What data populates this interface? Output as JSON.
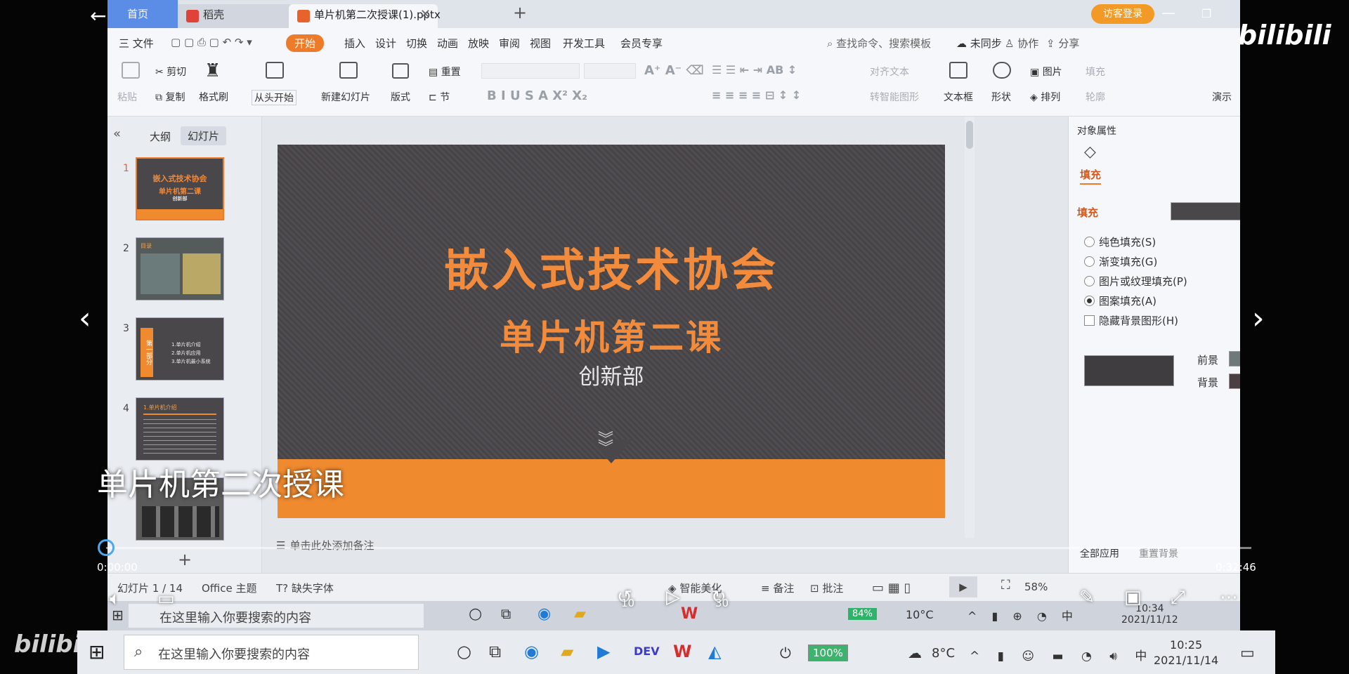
{
  "tabs": {
    "home": "首页",
    "daoke": "稻壳",
    "file": "单片机第二次授课(1).pptx",
    "login": "访客登录"
  },
  "menu": {
    "file": "三 文件",
    "items": [
      "开始",
      "插入",
      "设计",
      "切换",
      "动画",
      "放映",
      "审阅",
      "视图",
      "开发工具",
      "会员专享"
    ],
    "search": "查找命令、搜索模板",
    "sync": "未同步",
    "collab": "协作",
    "share": "分享"
  },
  "ribbon": {
    "paste": "粘贴",
    "cut": "剪切",
    "copy": "复制",
    "format_painter": "格式刷",
    "from_start": "从头开始",
    "new_slide": "新建幻灯片",
    "layout": "版式",
    "reset": "重置",
    "section": "节",
    "align_text": "对齐文本",
    "smartart": "转智能图形",
    "textbox": "文本框",
    "shape": "形状",
    "picture": "图片",
    "arrange": "排列",
    "fill": "填充",
    "outline": "轮廓",
    "present": "演示"
  },
  "panel": {
    "outline_tab": "大纲",
    "slides_tab": "幻灯片"
  },
  "thumbs": [
    {
      "num": "1",
      "t1": "嵌入式技术协会",
      "t2": "单片机第二课",
      "t3": "创新部"
    },
    {
      "num": "2",
      "t1": "目录"
    },
    {
      "num": "3",
      "t1": "第一部分",
      "l1": "1.单片机介绍",
      "l2": "2.单片机应用",
      "l3": "3.单片机最小系统"
    },
    {
      "num": "4",
      "t1": "1.单片机介绍"
    }
  ],
  "slide": {
    "title": "嵌入式技术协会",
    "subtitle": "单片机第二课",
    "department": "创新部"
  },
  "notes": "单击此处添加备注",
  "props": {
    "title": "对象属性",
    "tab": "填充",
    "fill_head": "填充",
    "opts": [
      "纯色填充(S)",
      "渐变填充(G)",
      "图片或纹理填充(P)",
      "图案填充(A)"
    ],
    "hide_bg": "隐藏背景图形(H)",
    "fg": "前景",
    "bg": "背景",
    "apply_all": "全部应用",
    "reset_bg": "重置背景"
  },
  "status": {
    "slide_count": "幻灯片 1 / 14",
    "theme": "Office 主题",
    "missing_font": "缺失字体",
    "beautify": "智能美化",
    "notes": "备注",
    "comment": "批注",
    "zoom": "58%"
  },
  "inner_taskbar": {
    "search": "在这里输入你要搜索的内容",
    "battery": "84%",
    "temp": "10°C",
    "time": "10:34",
    "date": "2021/11/12"
  },
  "video": {
    "title": "单片机第二次授课",
    "current": "0:00:00",
    "total": "0:32:46",
    "rewind": "10",
    "forward": "30",
    "brand": "bilibili"
  },
  "taskbar": {
    "search": "在这里输入你要搜索的内容",
    "battery": "100%",
    "temp": "8°C",
    "time": "10:25",
    "date": "2021/11/14"
  },
  "colors": {
    "accent": "#ee7b2a",
    "slide_bg": "#4a474b",
    "slide_text": "#f28b3c"
  }
}
